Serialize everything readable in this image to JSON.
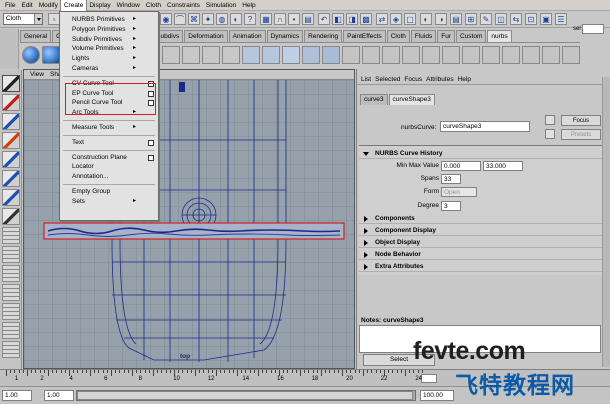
{
  "menubar": {
    "items": [
      "File",
      "Edit",
      "Modify",
      "Create",
      "Display",
      "Window",
      "Cloth",
      "Constraints",
      "Simulation",
      "Help"
    ],
    "active_index": 3
  },
  "status_line": {
    "mode": "Cloth",
    "sel_label": "sel"
  },
  "shelf": {
    "tabs": [
      "General",
      "Curves",
      "Surfaces",
      "Polygons",
      "Subdivs",
      "Deformation",
      "Animation",
      "Dynamics",
      "Rendering",
      "PaintEffects",
      "Cloth",
      "Fluids",
      "Fur",
      "Custom",
      "nurbs"
    ],
    "active_index": 14
  },
  "viewport": {
    "menu": [
      "View",
      "Shad"
    ],
    "camera_label": "top"
  },
  "create_menu": {
    "items": [
      {
        "label": "NURBS Primitives",
        "submenu": true
      },
      {
        "label": "Polygon Primitives",
        "submenu": true
      },
      {
        "label": "Subdiv Primitives",
        "submenu": true
      },
      {
        "label": "Volume Primitives",
        "submenu": true
      },
      {
        "label": "Lights",
        "submenu": true
      },
      {
        "label": "Cameras",
        "submenu": true
      },
      {
        "label": "CV Curve Tool",
        "option": true,
        "sep_before": true
      },
      {
        "label": "EP Curve Tool",
        "option": true
      },
      {
        "label": "Pencil Curve Tool",
        "option": true
      },
      {
        "label": "Arc Tools",
        "submenu": true
      },
      {
        "label": "Measure Tools",
        "submenu": true,
        "sep_before": true
      },
      {
        "label": "Text",
        "option": true,
        "sep_before": true
      },
      {
        "label": "Construction Plane",
        "option": true,
        "sep_before": true
      },
      {
        "label": "Locator"
      },
      {
        "label": "Annotation..."
      },
      {
        "label": "Empty Group",
        "sep_before": true
      },
      {
        "label": "Sets",
        "submenu": true
      }
    ],
    "submenu_arrow": "▸",
    "highlighted_labels": [
      "CV Curve Tool",
      "EP Curve Tool",
      "Pencil Curve Tool"
    ]
  },
  "attribute_editor": {
    "menu": [
      "List",
      "Selected",
      "Focus",
      "Attributes",
      "Help"
    ],
    "tabs": [
      "curve3",
      "curveShape3"
    ],
    "active_tab": 1,
    "node_label": "nurbsCurve:",
    "node_value": "curveShape3",
    "focus_button": "Focus",
    "presets_button": "Presets",
    "history_section": "NURBS Curve History",
    "min_max_label": "Min Max Value",
    "min_value": "0.000",
    "max_value": "33.000",
    "spans_label": "Spans",
    "spans_value": "33",
    "form_label": "Form",
    "form_value": "Open",
    "degree_label": "Degree",
    "degree_value": "3",
    "collapsed_sections": [
      "Components",
      "Component Display",
      "Object Display",
      "Node Behavior",
      "Extra Attributes"
    ],
    "notes_label": "Notes: curveShape3",
    "select_button": "Select"
  },
  "time_slider": {
    "ticks": [
      "1",
      "2",
      "4",
      "6",
      "8",
      "10",
      "12",
      "14",
      "16",
      "18",
      "20",
      "22",
      "24"
    ],
    "start_time": "1.00",
    "start_range": "1.00",
    "end_range": "100.00"
  },
  "watermark": {
    "latin": "fevte.com",
    "cjk": "飞特教程网"
  }
}
